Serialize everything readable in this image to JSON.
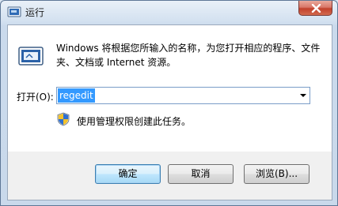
{
  "window": {
    "title": "运行",
    "close_icon": "close-icon",
    "app_icon": "run-window-icon"
  },
  "main": {
    "description": "Windows 将根据您所输入的名称，为您打开相应的程序、文件夹、文档或 Internet 资源。",
    "open_label": "打开(O):",
    "command_value": "regedit",
    "admin_note": "使用管理权限创建此任务。",
    "shield_icon": "uac-shield-icon"
  },
  "buttons": {
    "ok": "确定",
    "cancel": "取消",
    "browse": "浏览(B)..."
  },
  "colors": {
    "selection": "#3399ff",
    "close_button": "#c2412c",
    "default_button_border": "#3c7fb1"
  }
}
